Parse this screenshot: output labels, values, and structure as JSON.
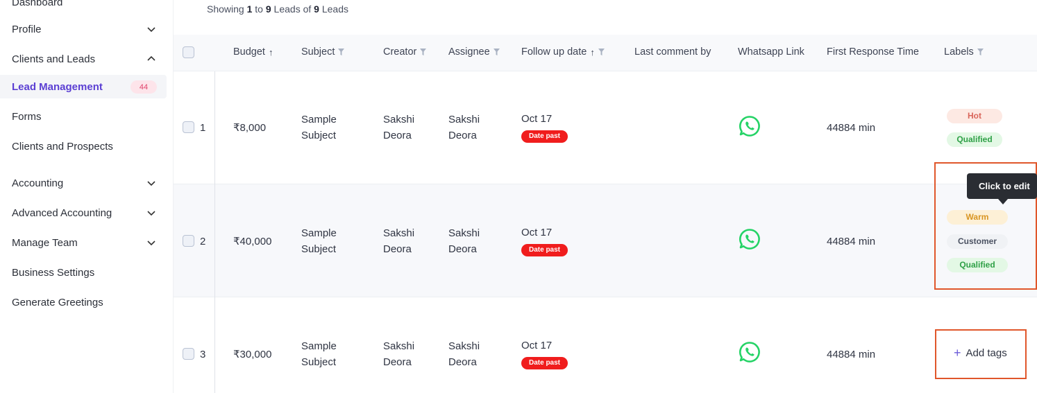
{
  "sidebar": {
    "items": [
      {
        "label": "Dashboard",
        "chevron": "none"
      },
      {
        "label": "Profile",
        "chevron": "down"
      },
      {
        "label": "Clients and Leads",
        "chevron": "up"
      },
      {
        "label": "Lead Management",
        "badge": "44",
        "active": true
      },
      {
        "label": "Forms"
      },
      {
        "label": "Clients and Prospects"
      },
      {
        "label": "Accounting",
        "chevron": "down"
      },
      {
        "label": "Advanced Accounting",
        "chevron": "down"
      },
      {
        "label": "Manage Team",
        "chevron": "down"
      },
      {
        "label": "Business Settings"
      },
      {
        "label": "Generate Greetings"
      }
    ]
  },
  "summary": {
    "prefix": "Showing ",
    "from": "1",
    "middle1": " to ",
    "to": "9",
    "middle2": " Leads of ",
    "total": "9",
    "suffix": " Leads"
  },
  "table": {
    "headers": {
      "budget": "Budget",
      "subject": "Subject",
      "creator": "Creator",
      "assignee": "Assignee",
      "follow_up": "Follow up date",
      "last_comment": "Last comment by",
      "whatsapp": "Whatsapp Link",
      "first_response": "First Response Time",
      "labels": "Labels"
    },
    "rows": [
      {
        "index": "1",
        "budget": "₹8,000",
        "subject_l1": "Sample",
        "subject_l2": "Subject",
        "creator_l1": "Sakshi",
        "creator_l2": "Deora",
        "assignee_l1": "Sakshi",
        "assignee_l2": "Deora",
        "follow_up": "Oct 17",
        "status": "Date past",
        "first_response": "44884 min",
        "labels": [
          "Hot",
          "Qualified"
        ]
      },
      {
        "index": "2",
        "budget": "₹40,000",
        "subject_l1": "Sample",
        "subject_l2": "Subject",
        "creator_l1": "Sakshi",
        "creator_l2": "Deora",
        "assignee_l1": "Sakshi",
        "assignee_l2": "Deora",
        "follow_up": "Oct 17",
        "status": "Date past",
        "first_response": "44884 min",
        "labels": [
          "Warm",
          "Customer",
          "Qualified"
        ]
      },
      {
        "index": "3",
        "budget": "₹30,000",
        "subject_l1": "Sample",
        "subject_l2": "Subject",
        "creator_l1": "Sakshi",
        "creator_l2": "Deora",
        "assignee_l1": "Sakshi",
        "assignee_l2": "Deora",
        "follow_up": "Oct 17",
        "status": "Date past",
        "first_response": "44884 min",
        "add_tags": "Add tags"
      }
    ]
  },
  "tooltip": "Click to edit",
  "colors": {
    "accent": "#5b3fd3",
    "danger": "#f01d1d",
    "highlight": "#e0562a",
    "whatsapp": "#25d366"
  }
}
